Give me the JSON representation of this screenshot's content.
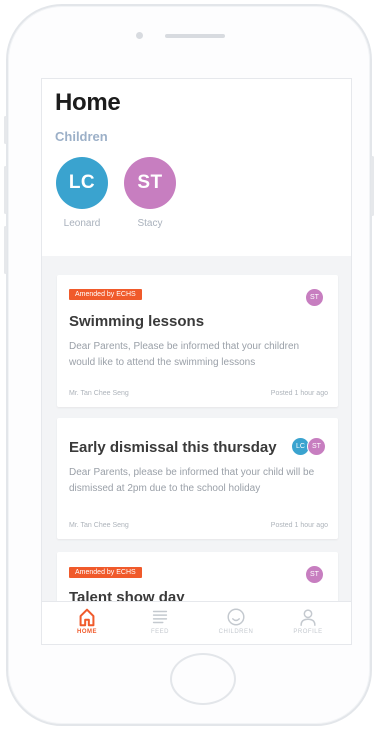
{
  "header": {
    "title": "Home",
    "children_label": "Children"
  },
  "children": [
    {
      "initials": "LC",
      "name": "Leonard",
      "color": "#3aa3cf"
    },
    {
      "initials": "ST",
      "name": "Stacy",
      "color": "#c77ec0"
    }
  ],
  "cards": [
    {
      "badge": "Amended by ECHS",
      "title": "Swimming lessons",
      "body": "Dear Parents, Please be informed that your children would like to attend the swimming lessons",
      "author": "Mr. Tan Chee Seng",
      "time": "Posted 1 hour ago",
      "avatars": [
        {
          "initials": "ST",
          "color": "#c77ec0"
        }
      ]
    },
    {
      "badge": "",
      "title": "Early dismissal this thursday",
      "body": "Dear Parents, please be informed that your child will be dismissed at 2pm due to the school holiday",
      "author": "Mr. Tan Chee Seng",
      "time": "Posted 1 hour ago",
      "avatars": [
        {
          "initials": "LC",
          "color": "#3aa3cf"
        },
        {
          "initials": "ST",
          "color": "#c77ec0"
        }
      ]
    },
    {
      "badge": "Amended by ECHS",
      "title": "Talent show day",
      "avatars": [
        {
          "initials": "ST",
          "color": "#c77ec0"
        }
      ]
    }
  ],
  "tabs": [
    {
      "label": "HOME",
      "icon": "home-icon",
      "active": true
    },
    {
      "label": "FEED",
      "icon": "feed-icon",
      "active": false
    },
    {
      "label": "CHILDREN",
      "icon": "children-icon",
      "active": false
    },
    {
      "label": "PROFILE",
      "icon": "profile-icon",
      "active": false
    }
  ],
  "colors": {
    "accent": "#f05a2b",
    "inactive": "#c4c9cf"
  }
}
